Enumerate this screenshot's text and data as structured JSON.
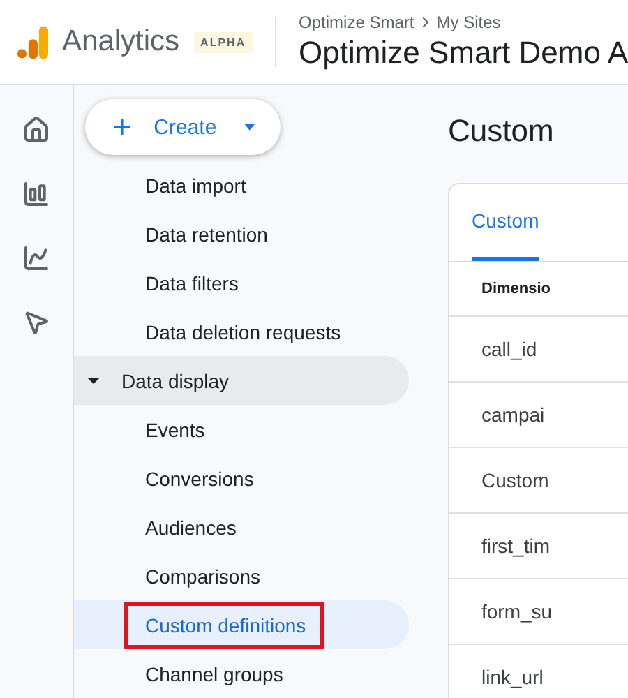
{
  "header": {
    "app_name": "Analytics",
    "badge": "ALPHA",
    "breadcrumb": [
      "Optimize Smart",
      "My Sites"
    ],
    "property": "Optimize Smart Demo A"
  },
  "rail": [
    {
      "kind": "home",
      "selected": false
    },
    {
      "kind": "reports",
      "selected": false
    },
    {
      "kind": "explore",
      "selected": false
    },
    {
      "kind": "advertising",
      "selected": false
    }
  ],
  "create_button": {
    "label": "Create"
  },
  "nav": {
    "items": [
      {
        "label": "Data import",
        "selected": false
      },
      {
        "label": "Data retention",
        "selected": false
      },
      {
        "label": "Data filters",
        "selected": false
      },
      {
        "label": "Data deletion requests",
        "selected": false
      }
    ],
    "group": {
      "label": "Data display",
      "expanded": true,
      "children": [
        {
          "label": "Events",
          "selected": false,
          "annotated": false
        },
        {
          "label": "Conversions",
          "selected": false,
          "annotated": false
        },
        {
          "label": "Audiences",
          "selected": false,
          "annotated": false
        },
        {
          "label": "Comparisons",
          "selected": false,
          "annotated": false
        },
        {
          "label": "Custom definitions",
          "selected": true,
          "annotated": true
        },
        {
          "label": "Channel groups",
          "selected": false,
          "annotated": false
        }
      ]
    }
  },
  "content": {
    "title": "Custom",
    "tabs": [
      {
        "label": "Custom",
        "selected": true
      }
    ],
    "table": {
      "columns": [
        "Dimensio"
      ],
      "rows": [
        [
          "call_id"
        ],
        [
          "campai"
        ],
        [
          "Custom"
        ],
        [
          "first_tim"
        ],
        [
          "form_su"
        ],
        [
          "link_url"
        ]
      ]
    }
  }
}
